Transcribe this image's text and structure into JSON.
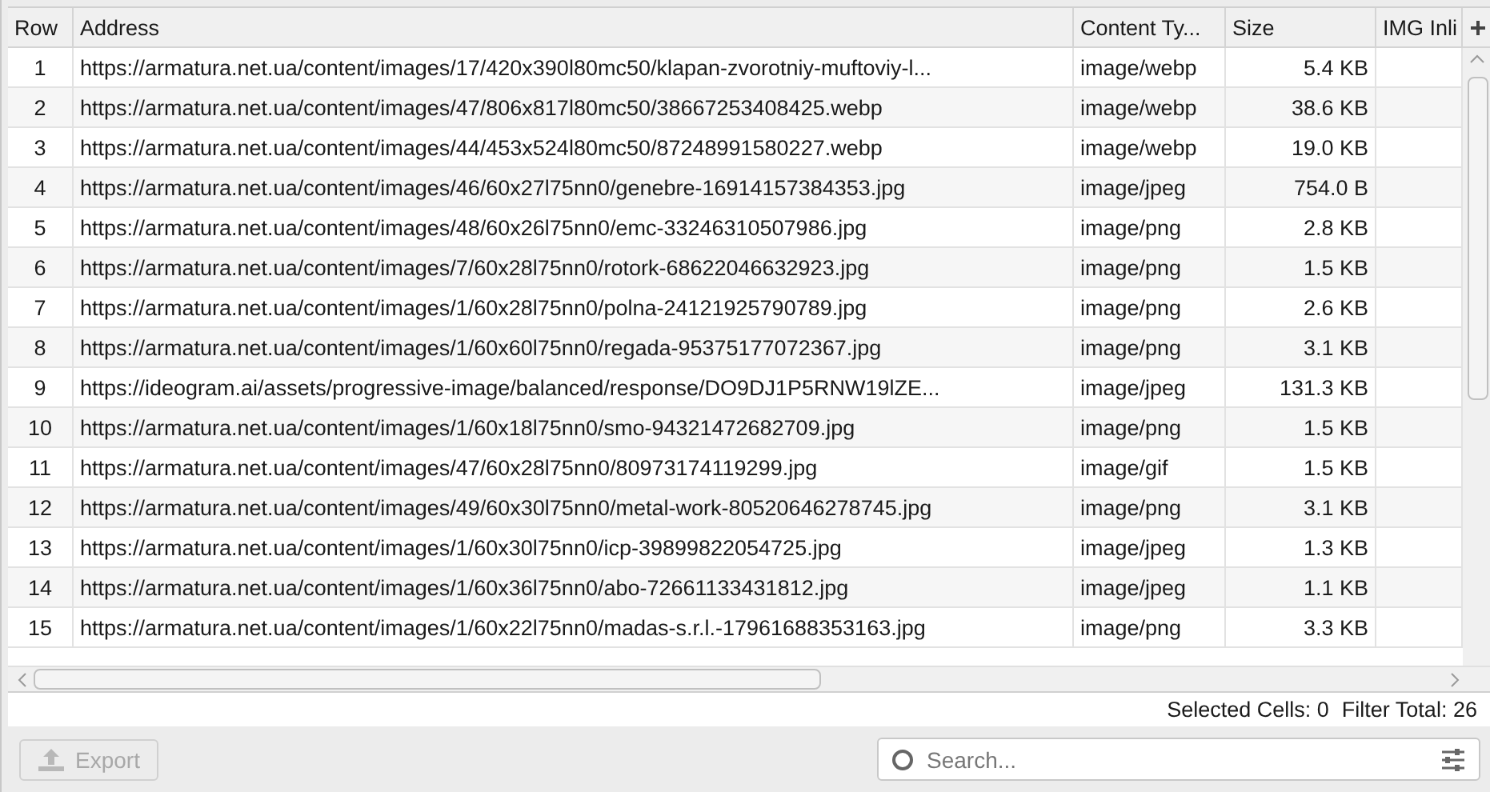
{
  "table": {
    "columns": [
      {
        "label": "Row"
      },
      {
        "label": "Address"
      },
      {
        "label": "Content Ty..."
      },
      {
        "label": "Size"
      },
      {
        "label": "IMG Inli"
      }
    ],
    "rows": [
      {
        "row": "1",
        "address": "https://armatura.net.ua/content/images/17/420x390l80mc50/klapan-zvorotniy-muftoviy-l...",
        "type": "image/webp",
        "size": "5.4 KB"
      },
      {
        "row": "2",
        "address": "https://armatura.net.ua/content/images/47/806x817l80mc50/38667253408425.webp",
        "type": "image/webp",
        "size": "38.6 KB"
      },
      {
        "row": "3",
        "address": "https://armatura.net.ua/content/images/44/453x524l80mc50/87248991580227.webp",
        "type": "image/webp",
        "size": "19.0 KB"
      },
      {
        "row": "4",
        "address": "https://armatura.net.ua/content/images/46/60x27l75nn0/genebre-16914157384353.jpg",
        "type": "image/jpeg",
        "size": "754.0 B"
      },
      {
        "row": "5",
        "address": "https://armatura.net.ua/content/images/48/60x26l75nn0/emc-33246310507986.jpg",
        "type": "image/png",
        "size": "2.8 KB"
      },
      {
        "row": "6",
        "address": "https://armatura.net.ua/content/images/7/60x28l75nn0/rotork-68622046632923.jpg",
        "type": "image/png",
        "size": "1.5 KB"
      },
      {
        "row": "7",
        "address": "https://armatura.net.ua/content/images/1/60x28l75nn0/polna-24121925790789.jpg",
        "type": "image/png",
        "size": "2.6 KB"
      },
      {
        "row": "8",
        "address": "https://armatura.net.ua/content/images/1/60x60l75nn0/regada-95375177072367.jpg",
        "type": "image/png",
        "size": "3.1 KB"
      },
      {
        "row": "9",
        "address": "https://ideogram.ai/assets/progressive-image/balanced/response/DO9DJ1P5RNW19lZE...",
        "type": "image/jpeg",
        "size": "131.3 KB"
      },
      {
        "row": "10",
        "address": "https://armatura.net.ua/content/images/1/60x18l75nn0/smo-94321472682709.jpg",
        "type": "image/png",
        "size": "1.5 KB"
      },
      {
        "row": "11",
        "address": "https://armatura.net.ua/content/images/47/60x28l75nn0/80973174119299.jpg",
        "type": "image/gif",
        "size": "1.5 KB"
      },
      {
        "row": "12",
        "address": "https://armatura.net.ua/content/images/49/60x30l75nn0/metal-work-80520646278745.jpg",
        "type": "image/png",
        "size": "3.1 KB"
      },
      {
        "row": "13",
        "address": "https://armatura.net.ua/content/images/1/60x30l75nn0/icp-39899822054725.jpg",
        "type": "image/jpeg",
        "size": "1.3 KB"
      },
      {
        "row": "14",
        "address": "https://armatura.net.ua/content/images/1/60x36l75nn0/abo-72661133431812.jpg",
        "type": "image/jpeg",
        "size": "1.1 KB"
      },
      {
        "row": "15",
        "address": "https://armatura.net.ua/content/images/1/60x22l75nn0/madas-s.r.l.-17961688353163.jpg",
        "type": "image/png",
        "size": "3.3 KB"
      }
    ]
  },
  "status_bar": {
    "selected_label": "Selected Cells:",
    "selected_value": "0",
    "filter_label": "Filter Total:",
    "filter_value": "26"
  },
  "export_button": {
    "label": "Export",
    "disabled": true
  },
  "search": {
    "placeholder": "Search..."
  }
}
